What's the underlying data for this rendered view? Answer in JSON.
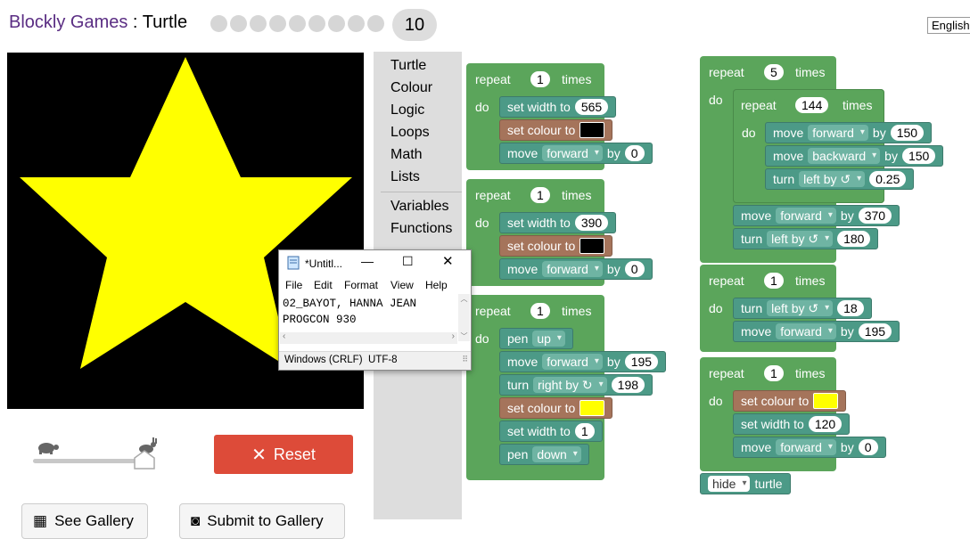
{
  "header": {
    "app_name": "Blockly Games",
    "separator": " : ",
    "page_name": "Turtle",
    "level": "10",
    "language": "English"
  },
  "controls": {
    "reset_label": "Reset",
    "see_gallery_label": "See Gallery",
    "submit_gallery_label": "Submit to Gallery",
    "speed_level": 0.9
  },
  "toolbox": {
    "items": [
      "Turtle",
      "Colour",
      "Logic",
      "Loops",
      "Math",
      "Lists",
      "Variables",
      "Functions"
    ]
  },
  "blocks": {
    "repeat": "repeat",
    "times": "times",
    "do": "do",
    "set_width": "set width to",
    "set_colour": "set colour to",
    "move": "move",
    "turn": "turn",
    "by": "by",
    "pen": "pen",
    "hide": "hide",
    "turtle": "turtle",
    "forward": "forward",
    "backward": "backward",
    "left_by": "left by ↺",
    "right_by": "right by ↻",
    "up": "up",
    "down": "down",
    "r1_count": "1",
    "r1_width": "565",
    "r1_colour": "#000000",
    "r1_move": "0",
    "r2_count": "1",
    "r2_width": "390",
    "r2_colour": "#000000",
    "r2_move": "0",
    "r3_count": "1",
    "r3_move": "195",
    "r3_turn": "198",
    "r3_colour": "#ffff00",
    "r3_width": "1",
    "r4_count": "5",
    "r4_inner_count": "144",
    "r4_fwd": "150",
    "r4_back": "150",
    "r4_turn_inner": "0.25",
    "r4_move": "370",
    "r4_turn": "180",
    "r5_count": "1",
    "r5_turn": "18",
    "r5_move": "195",
    "r6_count": "1",
    "r6_colour": "#ffff00",
    "r6_width": "120",
    "r6_move": "0"
  },
  "canvas": {
    "background": "#000000",
    "star_color": "#ffff00"
  },
  "notepad": {
    "title": "*Untitl...",
    "menu": [
      "File",
      "Edit",
      "Format",
      "View",
      "Help"
    ],
    "line1": "02_BAYOT, HANNA JEAN",
    "line2": "PROGCON 930",
    "status_eol": "Windows (CRLF)",
    "status_enc": "UTF-8"
  }
}
